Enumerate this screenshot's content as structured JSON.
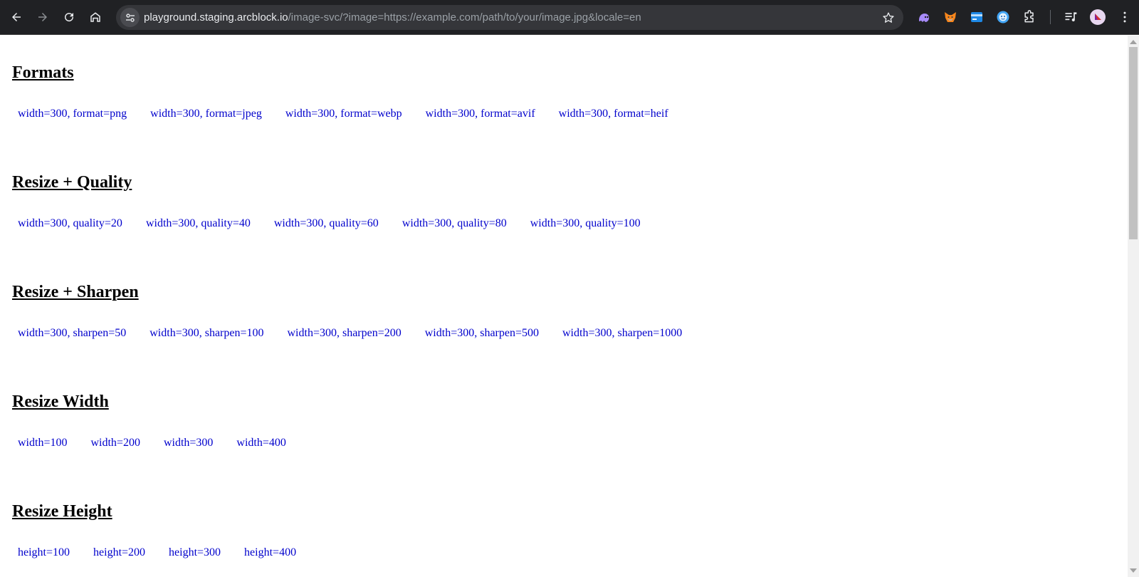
{
  "browser": {
    "url_host": "playground.staging.arcblock.io",
    "url_rest": "/image-svc/?image=https://example.com/path/to/your/image.jpg&locale=en",
    "icons": {
      "back": "back-arrow-icon",
      "forward": "forward-arrow-icon",
      "reload": "reload-icon",
      "home": "home-icon",
      "site_info": "tune-icon",
      "bookmark": "star-icon",
      "extensions": [
        "ghost-extension-icon",
        "fox-extension-icon",
        "card-extension-icon",
        "face-extension-icon",
        "puzzle-icon"
      ],
      "media": "media-list-icon",
      "profile": "avatar-icon",
      "menu": "kebab-menu-icon"
    }
  },
  "sections": [
    {
      "title": "Formats",
      "links": [
        "width=300, format=png",
        "width=300, format=jpeg",
        "width=300, format=webp",
        "width=300, format=avif",
        "width=300, format=heif"
      ]
    },
    {
      "title": "Resize + Quality",
      "links": [
        "width=300, quality=20",
        "width=300, quality=40",
        "width=300, quality=60",
        "width=300, quality=80",
        "width=300, quality=100"
      ]
    },
    {
      "title": "Resize + Sharpen",
      "links": [
        "width=300, sharpen=50",
        "width=300, sharpen=100",
        "width=300, sharpen=200",
        "width=300, sharpen=500",
        "width=300, sharpen=1000"
      ]
    },
    {
      "title": "Resize Width",
      "links": [
        "width=100",
        "width=200",
        "width=300",
        "width=400"
      ]
    },
    {
      "title": "Resize Height",
      "links": [
        "height=100",
        "height=200",
        "height=300",
        "height=400"
      ]
    }
  ],
  "colors": {
    "toolbar_bg": "#202124",
    "omnibox_bg": "#35363a",
    "link": "#0000cc",
    "heading": "#000000"
  }
}
